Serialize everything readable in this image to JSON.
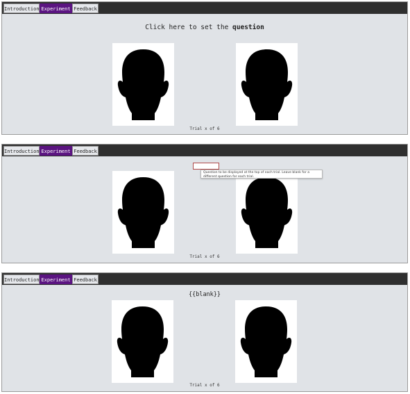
{
  "tabs": [
    "Introduction",
    "Experiment",
    "Feedback"
  ],
  "panel1": {
    "question_prefix": "Click here to set the ",
    "question_bold": "question",
    "trial_label": "Trial x of 6"
  },
  "panel2": {
    "input_value": "",
    "tooltip": "Question to be displayed at the top of each trial. Leave blank for a different question for each trial.",
    "trial_label": "Trial x of 6"
  },
  "panel3": {
    "question": "{{blank}}",
    "trial_label": "Trial x of 6"
  },
  "icons": {
    "face": "face-silhouette-icon"
  },
  "colors": {
    "active_tab": "#5b1481",
    "tabbar": "#2f2f2f",
    "panel_bg": "#e0e3e7",
    "face": "#000000"
  }
}
